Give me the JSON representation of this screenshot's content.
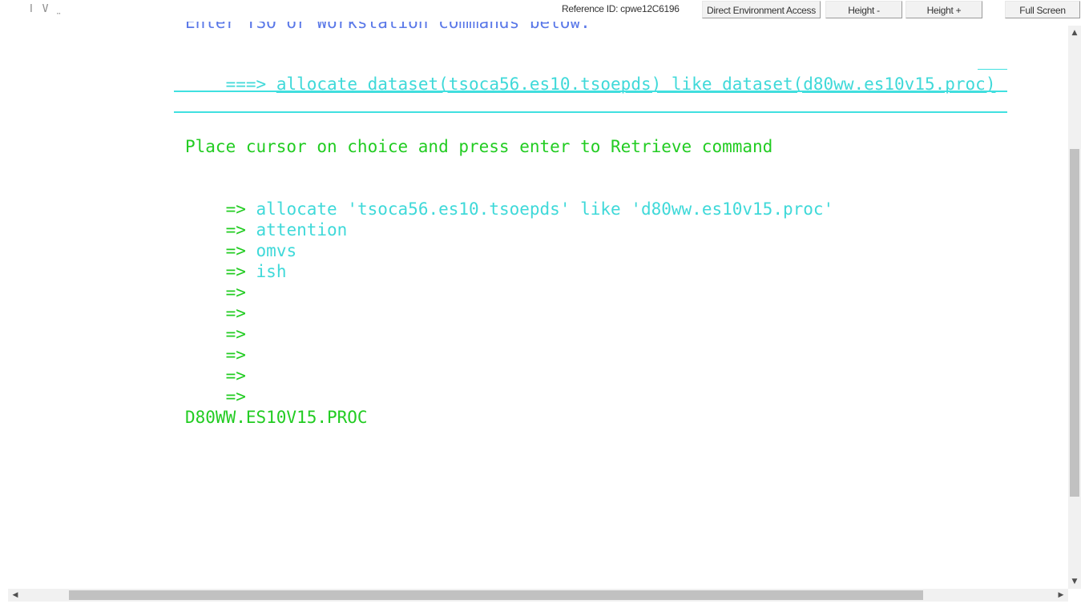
{
  "topbar": {
    "logo": "ǀ V ̤",
    "reference_id": "Reference ID: cpwe12C6196",
    "buttons": {
      "direct_access": "Direct Environment Access",
      "height_minus": "Height -",
      "height_plus": "Height +",
      "full_screen": "Full Screen"
    }
  },
  "terminal": {
    "partial_top_line": "Enter TSO or Workstation commands below:",
    "command_prompt": "===>",
    "command_value": "allocate dataset(tsoca56.es10.tsoepds) like dataset(d80ww.es10v15.proc)",
    "instruction": "Place cursor on choice and press enter to Retrieve command",
    "history_prompt": "=>",
    "history": [
      "allocate 'tsoca56.es10.tsoepds' like 'd80ww.es10v15.proc'",
      "attention",
      "omvs",
      "ish",
      "",
      "",
      "",
      "",
      "",
      ""
    ],
    "dataset_name": "D80WW.ES10V15.PROC"
  },
  "colors": {
    "green": "#22cc22",
    "cyan": "#3fd9d9",
    "blue": "#5a78e8",
    "rule": "#40e0e0"
  },
  "scrollbars": {
    "up_arrow_icon": "▲",
    "down_arrow_icon": "▼",
    "left_arrow_icon": "◀",
    "right_arrow_icon": "▶"
  }
}
